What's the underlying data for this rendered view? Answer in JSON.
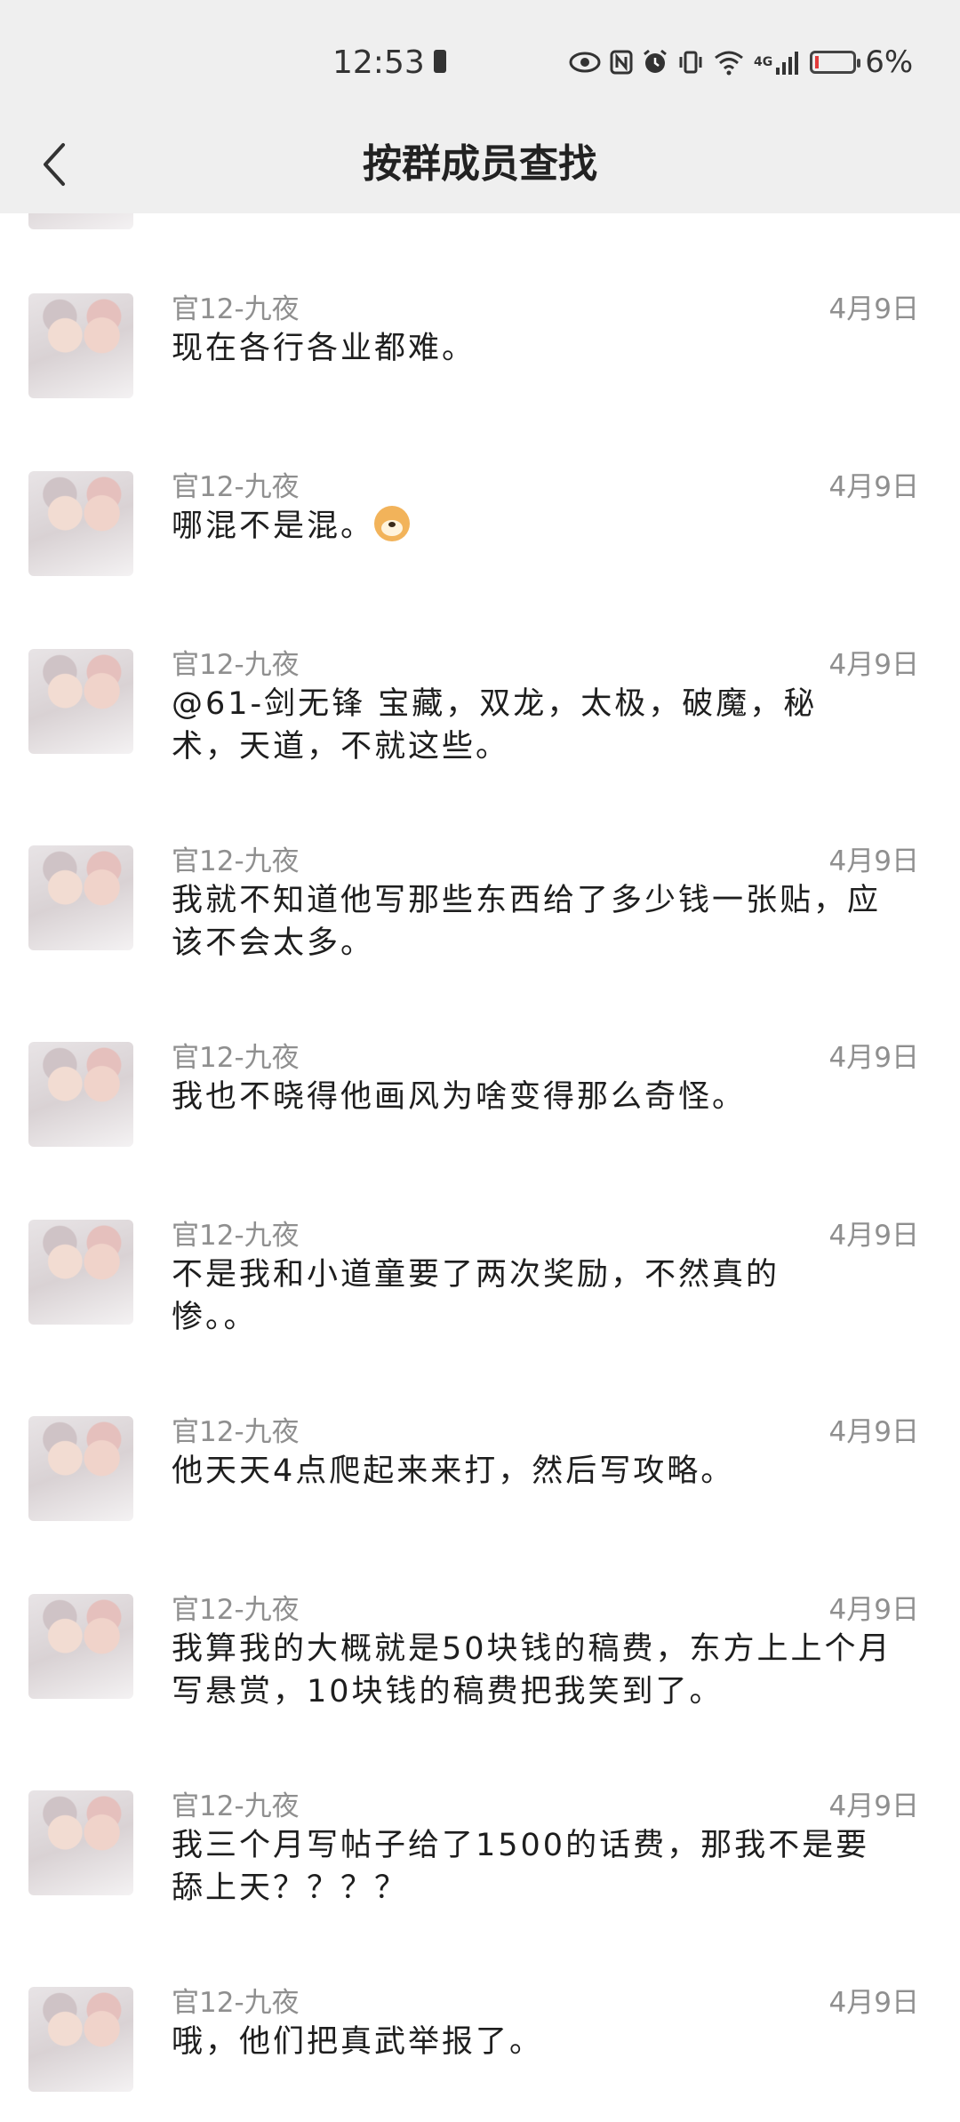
{
  "status_bar": {
    "time": "12:53",
    "icons": [
      "eye-icon",
      "nfc-icon",
      "alarm-icon",
      "vibrate-icon",
      "wifi-icon",
      "signal-icon"
    ],
    "network_label": "4G",
    "battery_percent": "6%"
  },
  "nav": {
    "title": "按群成员查找"
  },
  "messages": [
    {
      "sender": "官12-九夜",
      "date": "4月9日",
      "text": "现在各行各业都难。"
    },
    {
      "sender": "官12-九夜",
      "date": "4月9日",
      "text": "哪混不是混。"
    },
    {
      "sender": "官12-九夜",
      "date": "4月9日",
      "text": "@61-剑无锋 宝藏，双龙，太极，破魔，秘术，天道，不就这些。"
    },
    {
      "sender": "官12-九夜",
      "date": "4月9日",
      "text": "我就不知道他写那些东西给了多少钱一张贴，应该不会太多。"
    },
    {
      "sender": "官12-九夜",
      "date": "4月9日",
      "text": "我也不晓得他画风为啥变得那么奇怪。"
    },
    {
      "sender": "官12-九夜",
      "date": "4月9日",
      "text": "不是我和小道童要了两次奖励，不然真的惨。。"
    },
    {
      "sender": "官12-九夜",
      "date": "4月9日",
      "text": "他天天4点爬起来来打，然后写攻略。"
    },
    {
      "sender": "官12-九夜",
      "date": "4月9日",
      "text": "我算我的大概就是50块钱的稿费，东方上上个月写悬赏，10块钱的稿费把我笑到了。"
    },
    {
      "sender": "官12-九夜",
      "date": "4月9日",
      "text": "我三个月写帖子给了1500的话费，那我不是要舔上天？？？？"
    },
    {
      "sender": "官12-九夜",
      "date": "4月9日",
      "text": "哦，他们把真武举报了。"
    }
  ]
}
